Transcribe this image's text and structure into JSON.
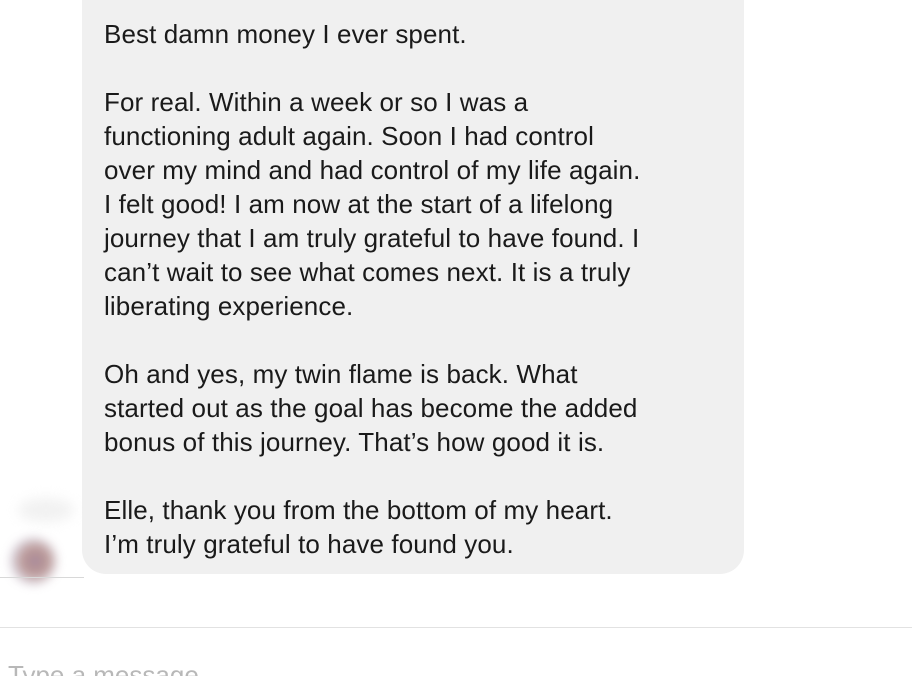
{
  "message": {
    "paragraphs": [
      "Best damn money I ever spent.",
      "For real. Within a week or so I was a\nfunctioning adult again. Soon I had control\nover my mind and had control of my life again.\nI felt good! I am now at the start of a lifelong\njourney that I am truly grateful to have found. I\ncan’t wait to see what comes next. It is a truly\nliberating experience.",
      "Oh and yes, my twin flame is back. What\nstarted out as the goal has become the added\nbonus of this journey. That’s how good it is.",
      "Elle, thank you from the bottom of my heart.\nI’m truly grateful to have found you."
    ],
    "bubble_color": "#f0f0f0",
    "text_color": "#1a1a1a"
  },
  "composer": {
    "placeholder": "Type a message..."
  },
  "sender": {
    "avatar_icon": "blurred-avatar"
  }
}
